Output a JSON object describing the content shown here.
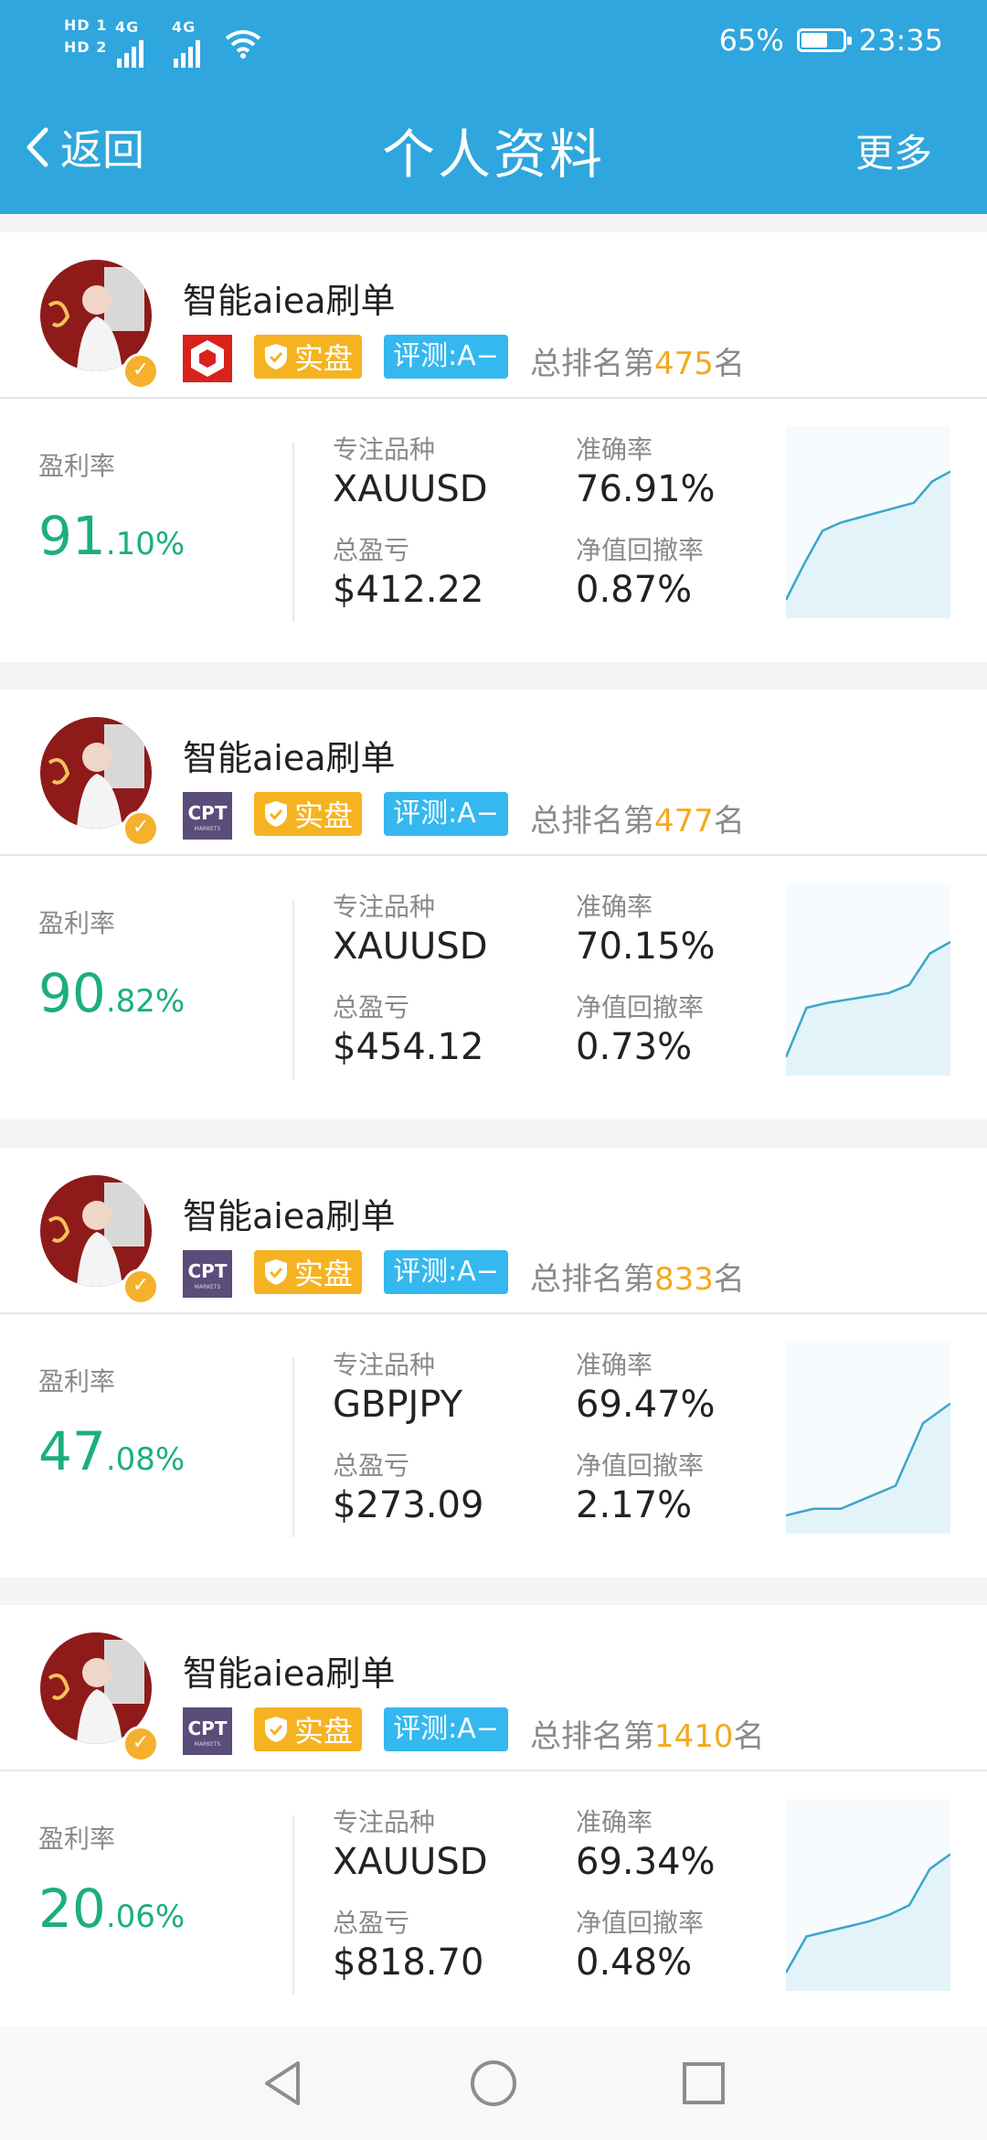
{
  "status_bar": {
    "hd1": "HD 1",
    "hd2": "HD 2",
    "net1": "4G",
    "net2": "4G",
    "battery": "65%",
    "battery_level": 0.65,
    "time": "23:35"
  },
  "header": {
    "back_label": "返回",
    "title": "个人资料",
    "more_label": "更多",
    "bg_color": "#2fa6dd"
  },
  "labels": {
    "profit_rate": "盈利率",
    "focus_symbol": "专注品种",
    "accuracy": "准确率",
    "total_pnl": "总盈亏",
    "drawdown": "净值回撤率",
    "real_badge": "实盘",
    "eval_badge": "评测:A−",
    "rank_prefix": "总排名第",
    "rank_suffix": "名"
  },
  "cards": [
    {
      "name": "智能aiea刷单",
      "broker_icon": "red-hexagon-broker-icon",
      "rank": "475",
      "profit_int": "91",
      "profit_dec": ".10%",
      "symbol": "XAUUSD",
      "accuracy": "76.91%",
      "pnl": "$412.22",
      "drawdown": "0.87%",
      "curve": [
        0.0,
        0.22,
        0.42,
        0.47,
        0.5,
        0.53,
        0.56,
        0.59,
        0.72,
        0.78
      ]
    },
    {
      "name": "智能aiea刷单",
      "broker_icon": "cpt-markets-broker-icon",
      "rank": "477",
      "profit_int": "90",
      "profit_dec": ".82%",
      "symbol": "XAUUSD",
      "accuracy": "70.15%",
      "pnl": "$454.12",
      "drawdown": "0.73%",
      "curve": [
        0.0,
        0.3,
        0.33,
        0.35,
        0.37,
        0.39,
        0.44,
        0.63,
        0.7
      ]
    },
    {
      "name": "智能aiea刷单",
      "broker_icon": "cpt-markets-broker-icon",
      "rank": "833",
      "profit_int": "47",
      "profit_dec": ".08%",
      "symbol": "GBPJPY",
      "accuracy": "69.47%",
      "pnl": "$273.09",
      "drawdown": "2.17%",
      "curve": [
        0.0,
        0.04,
        0.04,
        0.11,
        0.18,
        0.56,
        0.68
      ]
    },
    {
      "name": "智能aiea刷单",
      "broker_icon": "cpt-markets-broker-icon",
      "rank": "1410",
      "profit_int": "20",
      "profit_dec": ".06%",
      "symbol": "XAUUSD",
      "accuracy": "69.34%",
      "pnl": "$818.70",
      "drawdown": "0.48%",
      "curve": [
        0.0,
        0.22,
        0.25,
        0.28,
        0.31,
        0.35,
        0.41,
        0.63,
        0.72
      ]
    }
  ],
  "colors": {
    "profit_green": "#1cae7e",
    "rank_orange": "#f3a920",
    "real_badge": "#f6b321",
    "eval_badge": "#35b8ef",
    "curve_line": "#3aa6c9"
  }
}
